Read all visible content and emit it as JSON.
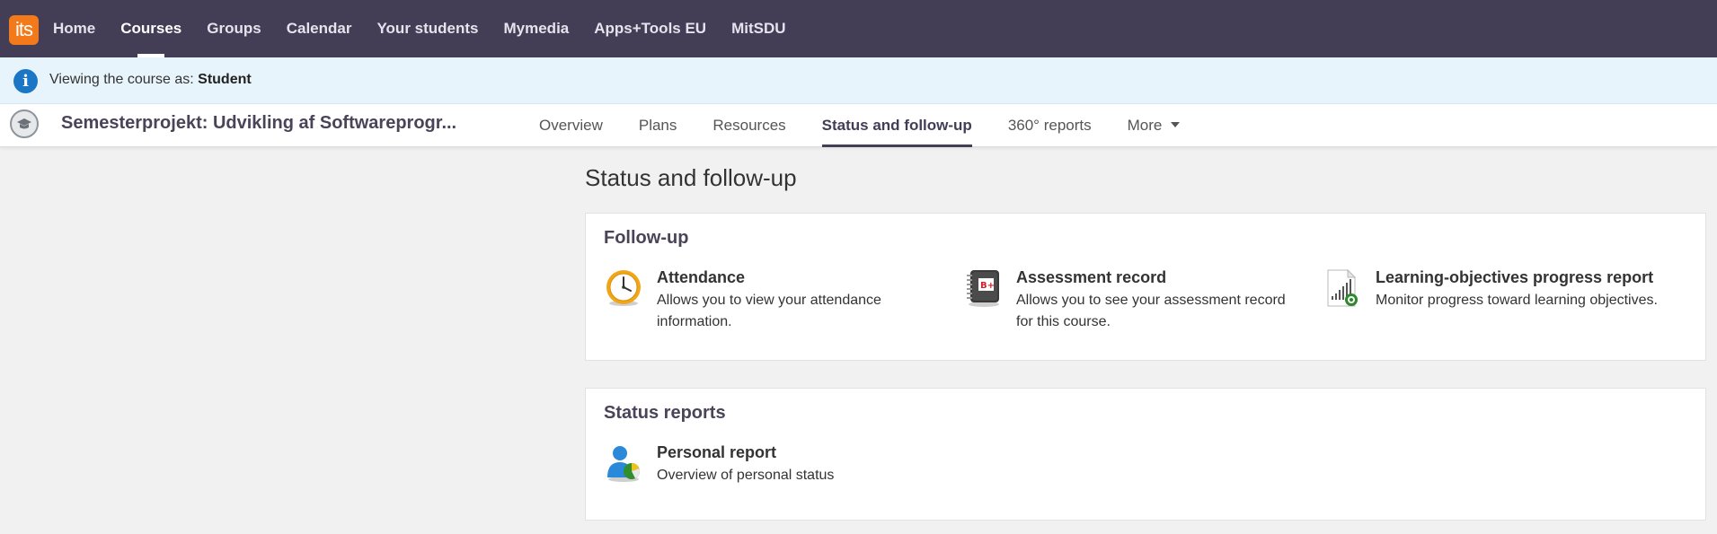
{
  "app": {
    "logo_text": "its"
  },
  "topnav": {
    "items": [
      {
        "label": "Home",
        "active": false
      },
      {
        "label": "Courses",
        "active": true
      },
      {
        "label": "Groups",
        "active": false
      },
      {
        "label": "Calendar",
        "active": false
      },
      {
        "label": "Your students",
        "active": false
      },
      {
        "label": "Mymedia",
        "active": false
      },
      {
        "label": "Apps+Tools EU",
        "active": false
      },
      {
        "label": "MitSDU",
        "active": false
      }
    ]
  },
  "banner": {
    "prefix": "Viewing the course as: ",
    "role": "Student",
    "icon": "info-icon"
  },
  "course": {
    "title": "Semesterprojekt: Udvikling af Softwareprogr...",
    "icon": "graduation-cap-icon",
    "tabs": [
      {
        "label": "Overview",
        "active": false
      },
      {
        "label": "Plans",
        "active": false
      },
      {
        "label": "Resources",
        "active": false
      },
      {
        "label": "Status and follow-up",
        "active": true
      },
      {
        "label": "360° reports",
        "active": false
      },
      {
        "label": "More",
        "active": false,
        "dropdown": true
      }
    ]
  },
  "main": {
    "page_title": "Status and follow-up",
    "followup": {
      "title": "Follow-up",
      "tools": [
        {
          "name": "Attendance",
          "description": "Allows you to view your attendance information.",
          "icon": "clock-icon"
        },
        {
          "name": "Assessment record",
          "description": "Allows you to see your assessment record for this course.",
          "icon": "grade-book-icon"
        },
        {
          "name": "Learning-objectives progress report",
          "description": "Monitor progress toward learning objectives.",
          "icon": "progress-report-icon"
        }
      ]
    },
    "status_reports": {
      "title": "Status reports",
      "tools": [
        {
          "name": "Personal report",
          "description": "Overview of personal status",
          "icon": "person-chart-icon"
        }
      ]
    }
  },
  "colors": {
    "topnav_bg": "#433d56",
    "logo_bg": "#f27a1a",
    "banner_bg": "#e8f4fb",
    "info_blue": "#1b77c5",
    "page_bg": "#f1f1f1"
  }
}
